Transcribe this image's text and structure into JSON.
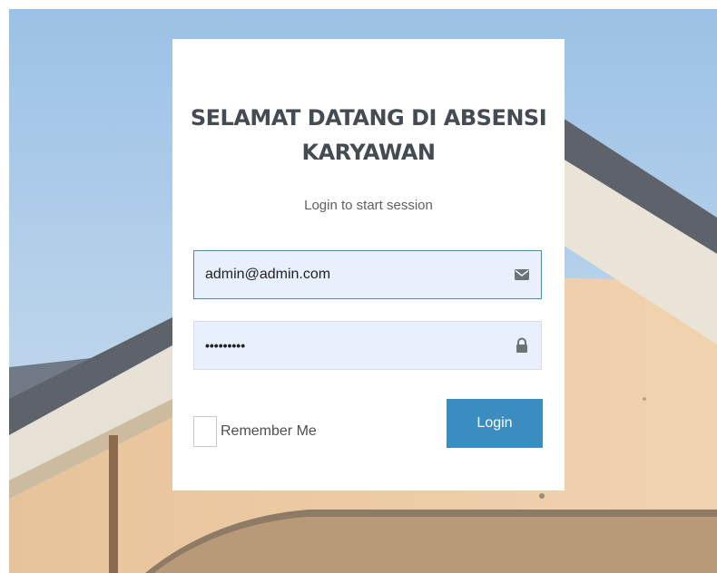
{
  "card": {
    "title_line1": "SELAMAT DATANG DI ABSENSI",
    "title_line2": "KARYAWAN",
    "subtitle": "Login to start session"
  },
  "form": {
    "email_value": "admin@admin.com",
    "email_icon": "envelope-icon",
    "password_value": "•••••••••",
    "password_icon": "lock-icon",
    "remember_label": "Remember Me",
    "remember_checked": false,
    "login_label": "Login"
  },
  "colors": {
    "button": "#3a8cc1",
    "input_bg": "#e8f0fe",
    "title": "#444b53"
  }
}
